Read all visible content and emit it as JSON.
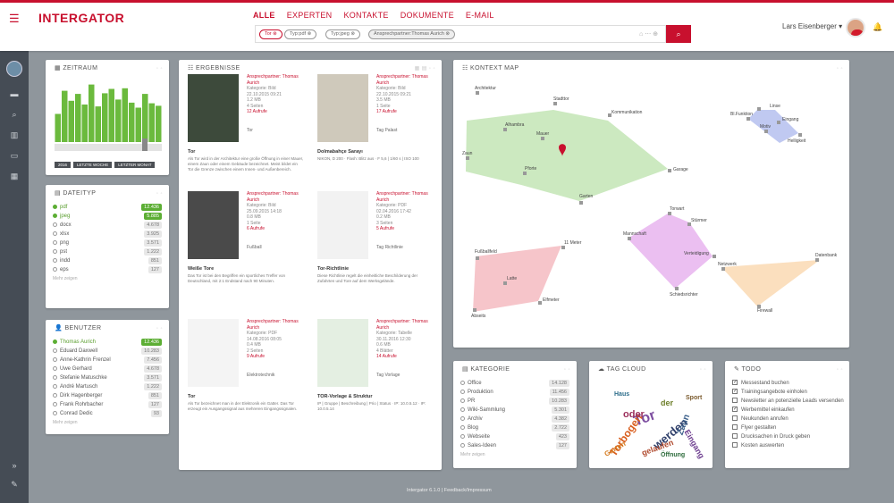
{
  "header": {
    "logo": "INTERGATOR",
    "nav": [
      "ALLE",
      "EXPERTEN",
      "KONTAKTE",
      "DOKUMENTE",
      "E-MAIL"
    ],
    "chips": [
      "Tor",
      "Typ:pdf",
      "Typ:jpeg",
      "Ansprechpartner:Thomas Aurich"
    ],
    "search_tools": "⌂ ⋯ ⊕",
    "user_name": "Lars Eisenberger ▾"
  },
  "panels": {
    "zeitraum": {
      "title": "ZEITRAUM",
      "buttons": [
        "2016",
        "LETZTE WOCHE",
        "LETZTER MONAT"
      ],
      "bars": [
        0.45,
        0.82,
        0.66,
        0.77,
        0.6,
        0.92,
        0.57,
        0.78,
        0.85,
        0.68,
        0.86,
        0.63,
        0.55,
        0.77,
        0.62,
        0.58
      ]
    },
    "dateityp": {
      "title": "DATEITYP",
      "items": [
        {
          "label": "pdf",
          "count": "12.436",
          "selected": true
        },
        {
          "label": "jpeg",
          "count": "5.885",
          "selected": true
        },
        {
          "label": "docx",
          "count": "4.678",
          "selected": false
        },
        {
          "label": "xlsx",
          "count": "3.925",
          "selected": false
        },
        {
          "label": "png",
          "count": "3.571",
          "selected": false
        },
        {
          "label": "pst",
          "count": "1.222",
          "selected": false
        },
        {
          "label": "indd",
          "count": "851",
          "selected": false
        },
        {
          "label": "eps",
          "count": "127",
          "selected": false
        }
      ],
      "more": "Mehr zeigen"
    },
    "benutzer": {
      "title": "BENUTZER",
      "items": [
        {
          "label": "Thomas Aurich",
          "count": "12.436",
          "selected": true
        },
        {
          "label": "Eduard Daxwell",
          "count": "10.283",
          "selected": false
        },
        {
          "label": "Anne-Kathrin Frenzel",
          "count": "7.456",
          "selected": false
        },
        {
          "label": "Uwe Gerhard",
          "count": "4.678",
          "selected": false
        },
        {
          "label": "Stefanie Matuschke",
          "count": "3.571",
          "selected": false
        },
        {
          "label": "André Martusch",
          "count": "1.222",
          "selected": false
        },
        {
          "label": "Dirk Hagenberger",
          "count": "851",
          "selected": false
        },
        {
          "label": "Frank Rohrbacher",
          "count": "127",
          "selected": false
        },
        {
          "label": "Conrad Dedic",
          "count": "93",
          "selected": false
        }
      ],
      "more": "Mehr zeigen"
    },
    "ergebnisse": {
      "title": "ERGEBNISSE",
      "results": [
        {
          "title": "Tor",
          "meta": [
            "Ansprechpartner: Thomas Aurich",
            "Kategorie: Bild",
            "22.10.2015 09:21",
            "1.2 MB",
            "4 Seiten",
            "12 Aufrufe"
          ],
          "tag": "Tor",
          "text": "Als Tor wird in der Architektur eine große Öffnung in einer Mauer, einem Zaun oder einem Gebäude bezeichnet. Meist bildet ein Tor die Grenze zwischen einem Innen- und Außenbereich."
        },
        {
          "title": "Dolmabahçe Sarayı",
          "meta": [
            "Ansprechpartner: Thomas Aurich",
            "Kategorie: Bild",
            "22.10.2015 09:21",
            "3.5 MB",
            "1 Seite",
            "17 Aufrufe"
          ],
          "tag": "Tag Palast",
          "text": "NIKON, D 200 · Flash: Blitz aus · F 5,6 | 1/60 s | ISO 100"
        },
        {
          "title": "Weiße Tore",
          "meta": [
            "Ansprechpartner: Thomas Aurich",
            "Kategorie: Bild",
            "25.09.2015 14:18",
            "0.8 MB",
            "1 Seite",
            "6 Aufrufe"
          ],
          "tag": "Fußball",
          "text": "Das Tor ist bei den Begriffen ein sportliches Treffer von Deutschland, mit 2:1 Endstand nach 90 Minuten."
        },
        {
          "title": "Tor-Richtlinie",
          "meta": [
            "Ansprechpartner: Thomas Aurich",
            "Kategorie: PDF",
            "02.04.2016 17:42",
            "0.2 MB",
            "3 Seiten",
            "5 Aufrufe"
          ],
          "tag": "Tag Richtlinie",
          "text": "Diese Richtlinie regelt die einheitliche Beschilderung der Zufahrten und Tore auf dem Werksgelände."
        },
        {
          "title": "Tor",
          "meta": [
            "Ansprechpartner: Thomas Aurich",
            "Kategorie: PDF",
            "14.08.2016 08:05",
            "0.4 MB",
            "2 Seiten",
            "9 Aufrufe"
          ],
          "tag": "Elektrotechnik",
          "text": "Als Tor bezeichnet man in der Elektronik ein Gatter. Das Tor erzeugt ein Ausgangssignal aus mehreren Eingangssignalen."
        },
        {
          "title": "TOR-Vorlage & Struktur",
          "meta": [
            "Ansprechpartner: Thomas Aurich",
            "Kategorie: Tabelle",
            "30.11.2016 12:30",
            "0.6 MB",
            "4 Blätter",
            "14 Aufrufe"
          ],
          "tag": "Tag Vorlage",
          "text": "IP | Gruppe | Beschreibung | Prio | Status · IP: 10.0.5.12 · IP: 10.0.5.14"
        }
      ]
    },
    "kontext": {
      "title": "KONTEXT MAP",
      "nodes_green": [
        "Architektur",
        "Stadttor",
        "Kommunikation",
        "Alhambra",
        "Mauer",
        "Zaun",
        "Pforte",
        "Garage",
        "Garten"
      ],
      "nodes_blue": [
        "Linse",
        "Eingang",
        "Motiv",
        "Helligkeit",
        "Bl.Funktion"
      ],
      "nodes_pink": [
        "Fußballfeld",
        "Latte",
        "Elfmeter",
        "11 Meter",
        "Abseits"
      ],
      "nodes_violet": [
        "Torwart",
        "Stürmer",
        "Verteidigung",
        "Mannschaft",
        "Schiedsrichter"
      ],
      "nodes_orange": [
        "Netzwerk",
        "Datenbank",
        "Firewall"
      ]
    },
    "kategorie": {
      "title": "KATEGORIE",
      "items": [
        {
          "label": "Office",
          "count": "14.128"
        },
        {
          "label": "Produktion",
          "count": "11.456"
        },
        {
          "label": "PR",
          "count": "10.283"
        },
        {
          "label": "Wiki-Sammlung",
          "count": "5.301"
        },
        {
          "label": "Archiv",
          "count": "4.382"
        },
        {
          "label": "Blog",
          "count": "2.722"
        },
        {
          "label": "Webseite",
          "count": "423"
        },
        {
          "label": "Sales-Ideen",
          "count": "127"
        }
      ],
      "more": "Mehr zeigen"
    },
    "tagcloud": {
      "title": "TAG CLOUD",
      "words": [
        "Tor",
        "Torbogen",
        "der",
        "werden",
        "oder",
        "Zaun",
        "Garten",
        "gelaufen",
        "Eingang",
        "Haus",
        "Sport",
        "Öffnung"
      ]
    },
    "todo": {
      "title": "TODO",
      "items": [
        {
          "label": "Messestand buchen",
          "done": true
        },
        {
          "label": "Trainingsangebote einholen",
          "done": true
        },
        {
          "label": "Newsletter an potenzielle Leads versenden",
          "done": false
        },
        {
          "label": "Werbemittel einkaufen",
          "done": true
        },
        {
          "label": "Neukunden anrufen",
          "done": false
        },
        {
          "label": "Flyer gestalten",
          "done": false
        },
        {
          "label": "Drucksachen in Druck geben",
          "done": false
        },
        {
          "label": "Kosten auswerten",
          "done": false
        }
      ]
    }
  },
  "footer": "Intergator 6.1.0 | Feedback/Impressum"
}
